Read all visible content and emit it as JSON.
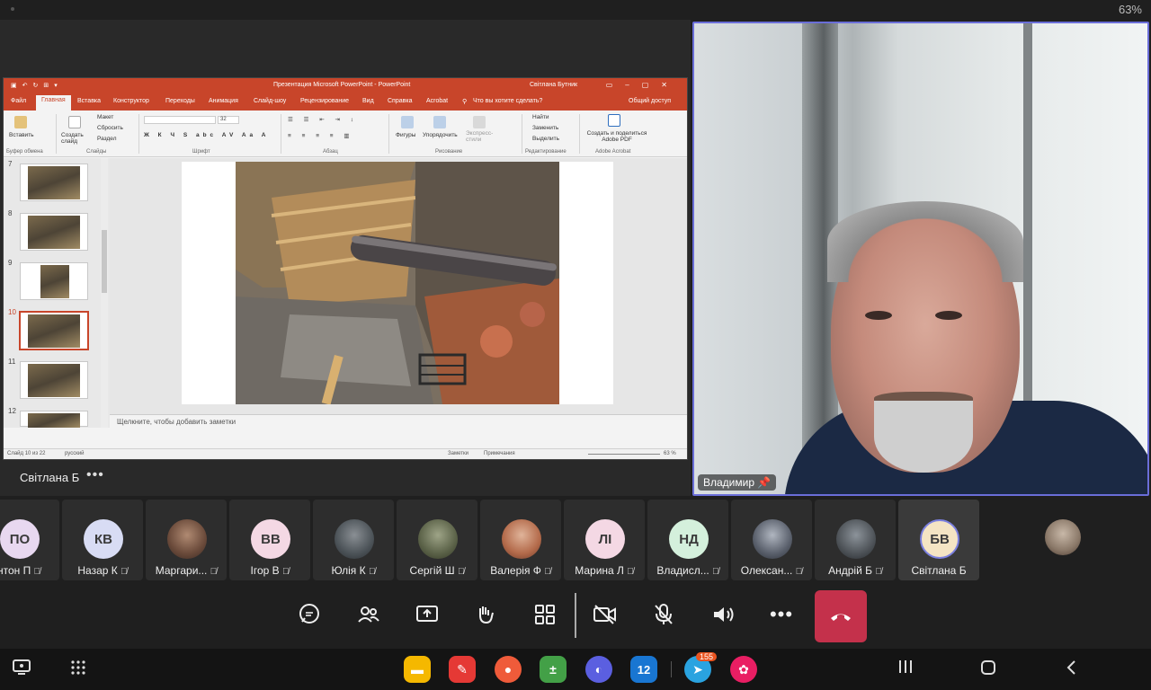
{
  "status": {
    "battery": "63%"
  },
  "ppt": {
    "title": "Презентация Microsoft PowerPoint  -  PowerPoint",
    "user": "Світлана Бутник",
    "tabs": [
      "Файл",
      "Главная",
      "Вставка",
      "Конструктор",
      "Переходы",
      "Анимация",
      "Слайд-шоу",
      "Рецензирование",
      "Вид",
      "Справка",
      "Acrobat"
    ],
    "search_hint": "Что вы хотите сделать?",
    "share": "Общий доступ",
    "ribbon": {
      "paste": "Вставить",
      "create_slide": "Создать слайд",
      "layout": "Макет",
      "reset": "Сбросить",
      "section": "Раздел",
      "shapes": "Фигуры",
      "arrange": "Упорядочить",
      "quick_styles": "Экспресс-стили",
      "find": "Найти",
      "replace": "Заменить",
      "select": "Выделить",
      "adobe": "Создать и поделиться Adobe PDF",
      "font_size": "32",
      "groups": [
        "Буфер обмена",
        "Слайды",
        "Шрифт",
        "Абзац",
        "Рисование",
        "Редактирование",
        "Adobe Acrobat"
      ]
    },
    "slides": [
      "7",
      "8",
      "9",
      "10",
      "11",
      "12"
    ],
    "notes_placeholder": "Щелкните, чтобы добавить заметки",
    "statusbar": {
      "slide_info": "Слайд 10 из 22",
      "language": "русский",
      "notes": "Заметки",
      "comments": "Примечания",
      "zoom": "63 %"
    }
  },
  "presenter_name": "Світлана Б",
  "video": {
    "name": "Владимир"
  },
  "participants": [
    {
      "initials": "ПО",
      "name": "нтон П",
      "color": "#e8d8f0"
    },
    {
      "initials": "КВ",
      "name": "Назар К",
      "color": "#d8dcf4"
    },
    {
      "initials": "",
      "name": "Маргари...",
      "color": ""
    },
    {
      "initials": "ВВ",
      "name": "Ігор В",
      "color": "#f4d8e4"
    },
    {
      "initials": "",
      "name": "Юлія К",
      "color": ""
    },
    {
      "initials": "",
      "name": "Сергій Ш",
      "color": ""
    },
    {
      "initials": "",
      "name": "Валерія Ф",
      "color": ""
    },
    {
      "initials": "ЛІ",
      "name": "Марина Л",
      "color": "#f4d8e4"
    },
    {
      "initials": "НД",
      "name": "Владисл...",
      "color": "#d4f0dc"
    },
    {
      "initials": "",
      "name": "Олексан...",
      "color": ""
    },
    {
      "initials": "",
      "name": "Андрій Б",
      "color": ""
    },
    {
      "initials": "БВ",
      "name": "Світлана Б",
      "color": "#f4e4c4"
    }
  ],
  "telegram_badge": "155",
  "calendar_day": "12"
}
